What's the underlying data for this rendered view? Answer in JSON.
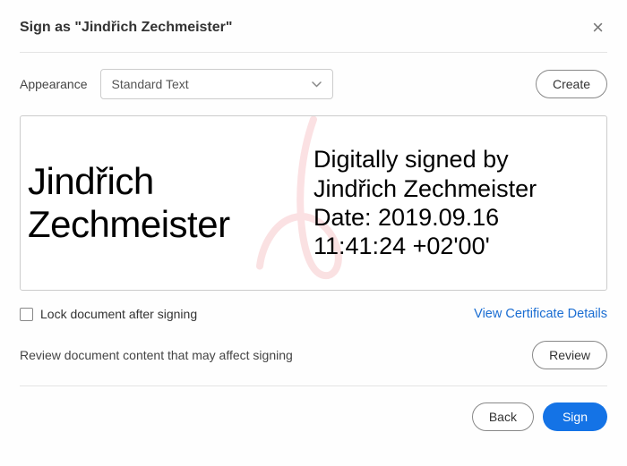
{
  "header": {
    "title": "Sign as \"Jindřich Zechmeister\""
  },
  "appearance": {
    "label": "Appearance",
    "selected": "Standard Text",
    "create_label": "Create"
  },
  "signature": {
    "name_line1": "Jindřich",
    "name_line2": "Zechmeister",
    "signed_by_line": "Digitally signed by",
    "signed_by_name": "Jindřich Zechmeister",
    "date_label": "Date: 2019.09.16",
    "time": "11:41:24 +02'00'"
  },
  "lock": {
    "label": "Lock document after signing"
  },
  "cert_link": "View Certificate Details",
  "review": {
    "text": "Review document content that may affect signing",
    "button": "Review"
  },
  "footer": {
    "back": "Back",
    "sign": "Sign"
  }
}
